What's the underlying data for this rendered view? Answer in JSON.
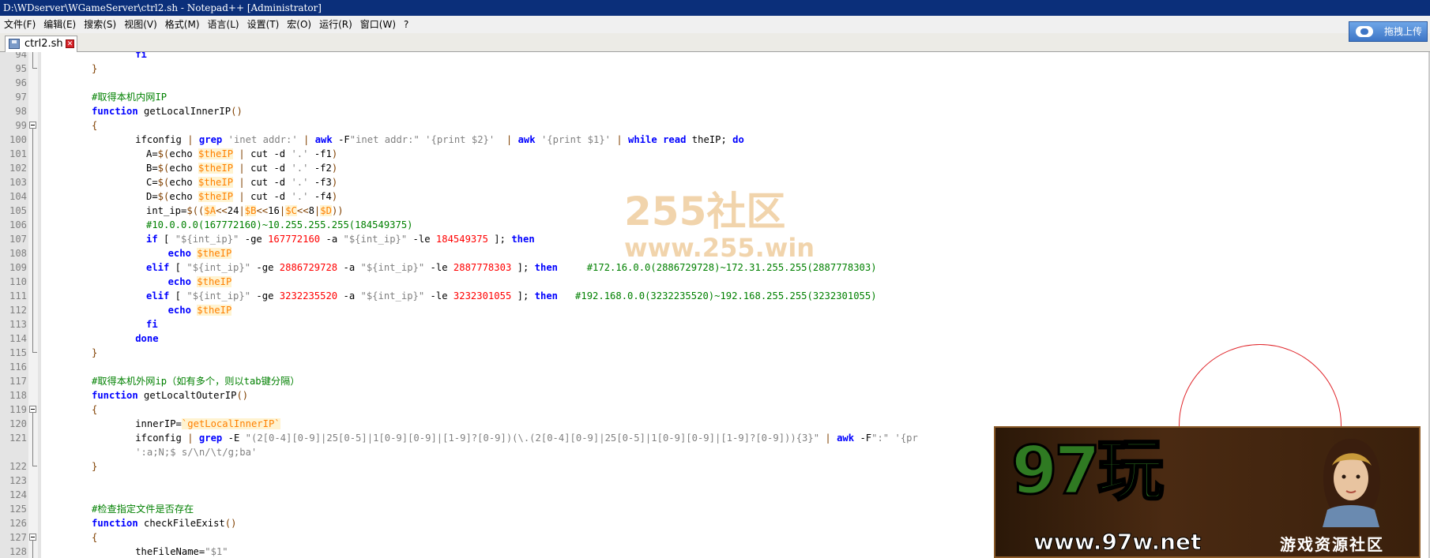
{
  "window": {
    "title": "D:\\WDserver\\WGameServer\\ctrl2.sh - Notepad++ [Administrator]"
  },
  "menu": [
    "文件(F)",
    "编辑(E)",
    "搜索(S)",
    "视图(V)",
    "格式(M)",
    "语言(L)",
    "设置(T)",
    "宏(O)",
    "运行(R)",
    "窗口(W)",
    "?"
  ],
  "tab": {
    "label": "ctrl2.sh",
    "icon": "disk-icon",
    "close_icon": "close-icon"
  },
  "upload_button": {
    "label": "拖拽上传",
    "icon": "cloud-icon"
  },
  "watermark": {
    "line1": "255社区",
    "line2": "www.255.win"
  },
  "ad": {
    "logo": "97玩",
    "site": "www.97w.net",
    "tagline": "游戏资源社区"
  },
  "editor": {
    "lines": [
      {
        "n": "94",
        "fold": "bar",
        "indent": 8,
        "tokens": [
          [
            "kw",
            "fi"
          ]
        ]
      },
      {
        "n": "95",
        "fold": "tail",
        "indent": 0,
        "tokens": [
          [
            "op",
            "}"
          ]
        ]
      },
      {
        "n": "96",
        "fold": "",
        "indent": 0,
        "tokens": []
      },
      {
        "n": "97",
        "fold": "",
        "indent": 0,
        "tokens": [
          [
            "com",
            "#取得本机内网IP"
          ]
        ]
      },
      {
        "n": "98",
        "fold": "",
        "indent": 0,
        "tokens": [
          [
            "kw",
            "function"
          ],
          [
            "pl",
            " getLocalInnerIP"
          ],
          [
            "op",
            "()"
          ]
        ]
      },
      {
        "n": "99",
        "fold": "box",
        "indent": 0,
        "tokens": [
          [
            "op",
            "{"
          ]
        ]
      },
      {
        "n": "100",
        "fold": "bar",
        "indent": 8,
        "tokens": [
          [
            "pl",
            "ifconfig "
          ],
          [
            "op",
            "|"
          ],
          [
            "pl",
            " "
          ],
          [
            "kw",
            "grep"
          ],
          [
            "pl",
            " "
          ],
          [
            "str",
            "'inet addr:'"
          ],
          [
            "pl",
            " "
          ],
          [
            "op",
            "|"
          ],
          [
            "pl",
            " "
          ],
          [
            "kw",
            "awk"
          ],
          [
            "pl",
            " -F"
          ],
          [
            "str",
            "\"inet addr:\""
          ],
          [
            "pl",
            " "
          ],
          [
            "str",
            "'{print $2}'"
          ],
          [
            "pl",
            "  "
          ],
          [
            "op",
            "|"
          ],
          [
            "pl",
            " "
          ],
          [
            "kw",
            "awk"
          ],
          [
            "pl",
            " "
          ],
          [
            "str",
            "'{print $1}'"
          ],
          [
            "pl",
            " "
          ],
          [
            "op",
            "|"
          ],
          [
            "pl",
            " "
          ],
          [
            "kw",
            "while"
          ],
          [
            "pl",
            " "
          ],
          [
            "kw",
            "read"
          ],
          [
            "pl",
            " theIP; "
          ],
          [
            "kw",
            "do"
          ]
        ]
      },
      {
        "n": "101",
        "fold": "bar",
        "indent": 10,
        "tokens": [
          [
            "pl",
            "A="
          ],
          [
            "op",
            "$("
          ],
          [
            "pl",
            "echo "
          ],
          [
            "var",
            "$theIP"
          ],
          [
            "pl",
            " "
          ],
          [
            "op",
            "|"
          ],
          [
            "pl",
            " cut -d "
          ],
          [
            "str",
            "'.'"
          ],
          [
            "pl",
            " -f1"
          ],
          [
            "op",
            ")"
          ]
        ]
      },
      {
        "n": "102",
        "fold": "bar",
        "indent": 10,
        "tokens": [
          [
            "pl",
            "B="
          ],
          [
            "op",
            "$("
          ],
          [
            "pl",
            "echo "
          ],
          [
            "var",
            "$theIP"
          ],
          [
            "pl",
            " "
          ],
          [
            "op",
            "|"
          ],
          [
            "pl",
            " cut -d "
          ],
          [
            "str",
            "'.'"
          ],
          [
            "pl",
            " -f2"
          ],
          [
            "op",
            ")"
          ]
        ]
      },
      {
        "n": "103",
        "fold": "bar",
        "indent": 10,
        "tokens": [
          [
            "pl",
            "C="
          ],
          [
            "op",
            "$("
          ],
          [
            "pl",
            "echo "
          ],
          [
            "var",
            "$theIP"
          ],
          [
            "pl",
            " "
          ],
          [
            "op",
            "|"
          ],
          [
            "pl",
            " cut -d "
          ],
          [
            "str",
            "'.'"
          ],
          [
            "pl",
            " -f3"
          ],
          [
            "op",
            ")"
          ]
        ]
      },
      {
        "n": "104",
        "fold": "bar",
        "indent": 10,
        "tokens": [
          [
            "pl",
            "D="
          ],
          [
            "op",
            "$("
          ],
          [
            "pl",
            "echo "
          ],
          [
            "var",
            "$theIP"
          ],
          [
            "pl",
            " "
          ],
          [
            "op",
            "|"
          ],
          [
            "pl",
            " cut -d "
          ],
          [
            "str",
            "'.'"
          ],
          [
            "pl",
            " -f4"
          ],
          [
            "op",
            ")"
          ]
        ]
      },
      {
        "n": "105",
        "fold": "bar",
        "indent": 10,
        "tokens": [
          [
            "pl",
            "int_ip="
          ],
          [
            "op",
            "$(("
          ],
          [
            "var",
            "$A"
          ],
          [
            "op",
            "<<"
          ],
          [
            "pl",
            "24"
          ],
          [
            "op",
            "|"
          ],
          [
            "var",
            "$B"
          ],
          [
            "op",
            "<<"
          ],
          [
            "pl",
            "16"
          ],
          [
            "op",
            "|"
          ],
          [
            "var",
            "$C"
          ],
          [
            "op",
            "<<"
          ],
          [
            "pl",
            "8"
          ],
          [
            "op",
            "|"
          ],
          [
            "var",
            "$D"
          ],
          [
            "op",
            "))"
          ]
        ]
      },
      {
        "n": "106",
        "fold": "bar",
        "indent": 10,
        "tokens": [
          [
            "com",
            "#10.0.0.0(167772160)~10.255.255.255(184549375)"
          ]
        ]
      },
      {
        "n": "107",
        "fold": "bar",
        "indent": 10,
        "tokens": [
          [
            "kw",
            "if"
          ],
          [
            "pl",
            " [ "
          ],
          [
            "str",
            "\"${int_ip}\""
          ],
          [
            "pl",
            " -ge "
          ],
          [
            "num",
            "167772160"
          ],
          [
            "pl",
            " -a "
          ],
          [
            "str",
            "\"${int_ip}\""
          ],
          [
            "pl",
            " -le "
          ],
          [
            "num",
            "184549375"
          ],
          [
            "pl",
            " ]; "
          ],
          [
            "kw",
            "then"
          ]
        ]
      },
      {
        "n": "108",
        "fold": "bar",
        "indent": 14,
        "tokens": [
          [
            "kw",
            "echo"
          ],
          [
            "pl",
            " "
          ],
          [
            "var",
            "$theIP"
          ]
        ]
      },
      {
        "n": "109",
        "fold": "bar",
        "indent": 10,
        "tokens": [
          [
            "kw",
            "elif"
          ],
          [
            "pl",
            " [ "
          ],
          [
            "str",
            "\"${int_ip}\""
          ],
          [
            "pl",
            " -ge "
          ],
          [
            "num",
            "2886729728"
          ],
          [
            "pl",
            " -a "
          ],
          [
            "str",
            "\"${int_ip}\""
          ],
          [
            "pl",
            " -le "
          ],
          [
            "num",
            "2887778303"
          ],
          [
            "pl",
            " ]; "
          ],
          [
            "kw",
            "then"
          ],
          [
            "pl",
            "     "
          ],
          [
            "com",
            "#172.16.0.0(2886729728)~172.31.255.255(2887778303)"
          ]
        ]
      },
      {
        "n": "110",
        "fold": "bar",
        "indent": 14,
        "tokens": [
          [
            "kw",
            "echo"
          ],
          [
            "pl",
            " "
          ],
          [
            "var",
            "$theIP"
          ]
        ]
      },
      {
        "n": "111",
        "fold": "bar",
        "indent": 10,
        "tokens": [
          [
            "kw",
            "elif"
          ],
          [
            "pl",
            " [ "
          ],
          [
            "str",
            "\"${int_ip}\""
          ],
          [
            "pl",
            " -ge "
          ],
          [
            "num",
            "3232235520"
          ],
          [
            "pl",
            " -a "
          ],
          [
            "str",
            "\"${int_ip}\""
          ],
          [
            "pl",
            " -le "
          ],
          [
            "num",
            "3232301055"
          ],
          [
            "pl",
            " ]; "
          ],
          [
            "kw",
            "then"
          ],
          [
            "pl",
            "   "
          ],
          [
            "com",
            "#192.168.0.0(3232235520)~192.168.255.255(3232301055)"
          ]
        ]
      },
      {
        "n": "112",
        "fold": "bar",
        "indent": 14,
        "tokens": [
          [
            "kw",
            "echo"
          ],
          [
            "pl",
            " "
          ],
          [
            "var",
            "$theIP"
          ]
        ]
      },
      {
        "n": "113",
        "fold": "bar",
        "indent": 10,
        "tokens": [
          [
            "kw",
            "fi"
          ]
        ]
      },
      {
        "n": "114",
        "fold": "bar",
        "indent": 8,
        "tokens": [
          [
            "kw",
            "done"
          ]
        ]
      },
      {
        "n": "115",
        "fold": "tail",
        "indent": 0,
        "tokens": [
          [
            "op",
            "}"
          ]
        ]
      },
      {
        "n": "116",
        "fold": "",
        "indent": 0,
        "tokens": []
      },
      {
        "n": "117",
        "fold": "",
        "indent": 0,
        "tokens": [
          [
            "com",
            "#取得本机外网ip（如有多个，则以tab键分隔）"
          ]
        ]
      },
      {
        "n": "118",
        "fold": "",
        "indent": 0,
        "tokens": [
          [
            "kw",
            "function"
          ],
          [
            "pl",
            " getLocaltOuterIP"
          ],
          [
            "op",
            "()"
          ]
        ]
      },
      {
        "n": "119",
        "fold": "box",
        "indent": 0,
        "tokens": [
          [
            "op",
            "{"
          ]
        ]
      },
      {
        "n": "120",
        "fold": "bar",
        "indent": 8,
        "tokens": [
          [
            "pl",
            "innerIP="
          ],
          [
            "var",
            "`getLocalInnerIP`"
          ]
        ]
      },
      {
        "n": "121",
        "fold": "bar",
        "indent": 8,
        "tokens": [
          [
            "pl",
            "ifconfig "
          ],
          [
            "op",
            "|"
          ],
          [
            "pl",
            " "
          ],
          [
            "kw",
            "grep"
          ],
          [
            "pl",
            " -E "
          ],
          [
            "str",
            "\"(2[0-4][0-9]|25[0-5]|1[0-9][0-9]|[1-9]?[0-9])(\\.(2[0-4][0-9]|25[0-5]|1[0-9][0-9]|[1-9]?[0-9])){3}\""
          ],
          [
            "pl",
            " "
          ],
          [
            "op",
            "|"
          ],
          [
            "pl",
            " "
          ],
          [
            "kw",
            "awk"
          ],
          [
            "pl",
            " -F"
          ],
          [
            "str",
            "\":\""
          ],
          [
            "pl",
            " "
          ],
          [
            "str",
            "'{pr"
          ]
        ]
      },
      {
        "n": "",
        "fold": "bar",
        "indent": 8,
        "tokens": [
          [
            "str",
            "':a;N;$ s/\\n/\\t/g;ba'"
          ]
        ]
      },
      {
        "n": "122",
        "fold": "tail",
        "indent": 0,
        "tokens": [
          [
            "op",
            "}"
          ]
        ]
      },
      {
        "n": "123",
        "fold": "",
        "indent": 0,
        "tokens": []
      },
      {
        "n": "124",
        "fold": "",
        "indent": 0,
        "tokens": []
      },
      {
        "n": "125",
        "fold": "",
        "indent": 0,
        "tokens": [
          [
            "com",
            "#检查指定文件是否存在"
          ]
        ]
      },
      {
        "n": "126",
        "fold": "",
        "indent": 0,
        "tokens": [
          [
            "kw",
            "function"
          ],
          [
            "pl",
            " checkFileExist"
          ],
          [
            "op",
            "()"
          ]
        ]
      },
      {
        "n": "127",
        "fold": "box",
        "indent": 0,
        "tokens": [
          [
            "op",
            "{"
          ]
        ]
      },
      {
        "n": "128",
        "fold": "bar",
        "indent": 8,
        "tokens": [
          [
            "pl",
            "theFileName="
          ],
          [
            "str",
            "\"$1\""
          ]
        ]
      }
    ]
  }
}
